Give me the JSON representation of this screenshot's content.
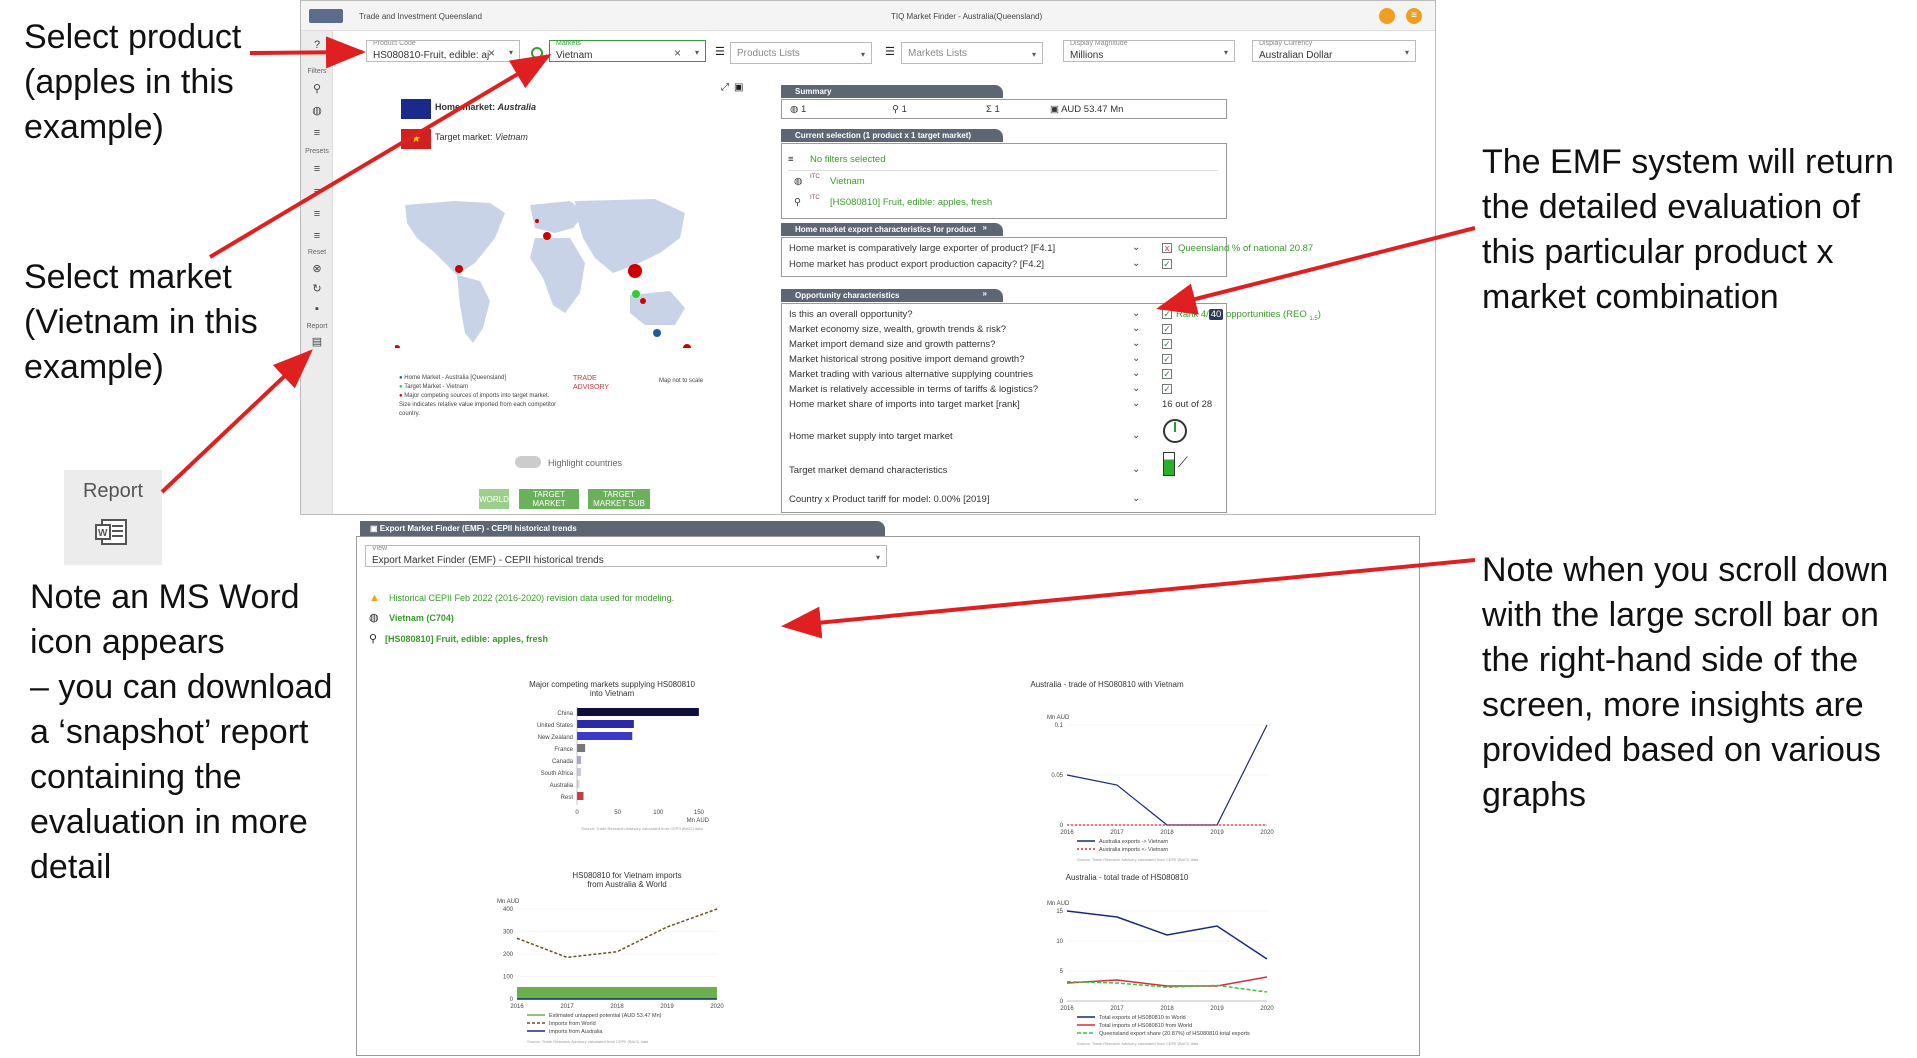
{
  "annotations": {
    "select_product": [
      "Select product",
      "(apples in this",
      "example)"
    ],
    "select_market": [
      "Select market",
      "(Vietnam in this",
      "example)"
    ],
    "report_label": "Report",
    "word_note": [
      "Note an MS Word",
      "icon appears",
      "– you can download",
      "a ‘snapshot’ report",
      "containing the",
      "evaluation in more",
      "detail"
    ],
    "emf_note": [
      "The EMF system will return",
      "the detailed evaluation of",
      "this particular product x",
      "market combination"
    ],
    "scroll_note": [
      "Note when you scroll down",
      "with the large scroll bar on",
      "the right-hand side of the",
      "screen, more insights are",
      "provided based on various",
      "graphs"
    ],
    "arrow_color": "#e02020"
  },
  "topbar": {
    "brand": "Trade and Investment Queensland",
    "title": "TIQ Market Finder - Australia(Queensland)"
  },
  "sidebar": {
    "filters": "Filters",
    "presets": "Presets",
    "reset": "Reset",
    "report": "Report"
  },
  "fields": {
    "product": {
      "caption": "Product Code",
      "value": "HS080810-Fruit, edible: aj"
    },
    "markets": {
      "caption": "Markets",
      "value": "Vietnam"
    },
    "products_lists": {
      "placeholder": "Products Lists"
    },
    "markets_lists": {
      "placeholder": "Markets Lists"
    },
    "magnitude": {
      "caption": "Display Magnitude",
      "value": "Millions"
    },
    "currency": {
      "caption": "Display Currency",
      "value": "Australian Dollar"
    }
  },
  "map": {
    "home_label": "Home market: ",
    "home_value": "Australia",
    "target_label": "Target market: ",
    "target_value": "Vietnam",
    "legend": [
      "Home Market - Australia [Queensland]",
      "Target Market - Vietnam",
      "Major competing sources of imports into target market.",
      "Size indicates relative value imported from each competitor",
      "country."
    ],
    "brand": "TRADE ADVISORY",
    "scale_note": "Map not to scale",
    "highlight": "Highlight countries",
    "buttons": [
      "WORLD",
      "TARGET MARKET REGION",
      "TARGET MARKET SUB REGION"
    ]
  },
  "summary": {
    "header": "Summary",
    "markets": "1",
    "products": "1",
    "combos": "1",
    "value": "AUD 53.47 Mn"
  },
  "selection": {
    "header": "Current selection (1 product x 1 target market)",
    "filters": "No filters selected",
    "market": "Vietnam",
    "product": "[HS080810] Fruit, edible: apples, fresh",
    "itc": "ITC"
  },
  "home_chars": {
    "header": "Home market export characteristics for product",
    "rows": [
      {
        "text": "Home market is comparatively large exporter of product? [F4.1]",
        "mark": "x",
        "note": "Queensland % of national 20.87"
      },
      {
        "text": "Home market has product export production capacity? [F4.2]",
        "mark": "✓",
        "note": ""
      }
    ]
  },
  "opp_chars": {
    "header": "Opportunity characteristics",
    "rank_prefix": "Rank 4/",
    "rank_badge": "40",
    "rank_suffix": "opportunities (REO",
    "rank_sub": "1.5",
    "rows": [
      "Is this an overall opportunity?",
      "Market economy size, wealth, growth trends & risk?",
      "Market import demand size and growth patterns?",
      "Market historical strong positive import demand growth?",
      "Market trading with various alternative supplying countries",
      "Market is relatively accessible in terms of tariffs & logistics?",
      "Home market share of imports into target market [rank]"
    ],
    "share_rank": "16 out of 28",
    "supply": "Home market supply into target market",
    "demand": "Target market demand characteristics",
    "tariff": "Country x Product tariff for model: 0.00% [2019]"
  },
  "emf": {
    "header": "Export Market Finder (EMF) - CEPII historical trends",
    "view_caption": "View",
    "view_value": "Export Market Finder (EMF) - CEPII historical trends",
    "note": "Historical CEPII Feb 2022 (2016-2020) revision data used for modeling.",
    "market": "Vietnam (C704)",
    "product": "[HS080810] Fruit, edible: apples, fresh"
  },
  "chart_data": [
    {
      "type": "bar",
      "title": "Major competing markets supplying HS080810 into Vietnam",
      "categories": [
        "China",
        "United States",
        "New Zealand",
        "France",
        "Canada",
        "South Africa",
        "Australia",
        "Rest"
      ],
      "values": [
        150,
        70,
        68,
        10,
        5,
        5,
        3,
        8
      ],
      "xlabel": "Mn AUD",
      "xticks": [
        "0",
        "50",
        "100",
        "150"
      ],
      "xlim": [
        0,
        160
      ],
      "colors": [
        "#0e0e3a",
        "#2a2aa8",
        "#3a3ac8",
        "#777777",
        "#aaaacc",
        "#c8c8d8",
        "#d8d8e0",
        "#c83a4a"
      ],
      "source": "Source: Trade Research Advisory calculated from CEPII (BACI) data"
    },
    {
      "type": "line",
      "title": "Australia - trade of HS080810 with Vietnam",
      "ylabel": "Mn AUD",
      "x": [
        2016,
        2017,
        2018,
        2019,
        2020
      ],
      "yticks": [
        "0",
        "0.05",
        "0.1"
      ],
      "ylim": [
        0,
        0.1
      ],
      "series": [
        {
          "name": "Australia exports -> Vietnam",
          "values": [
            0.05,
            0.04,
            0.0,
            0.0,
            0.1
          ],
          "color": "#1a2a7a"
        },
        {
          "name": "Australia imports <- Vietnam",
          "values": [
            0,
            0,
            0,
            0,
            0
          ],
          "color": "#d03040"
        }
      ],
      "source": "Source: Trade Research Advisory calculated from CEPII (BACI) data"
    },
    {
      "type": "line",
      "title": "HS080810 for Vietnam imports from Australia & World",
      "ylabel": "Mn AUD",
      "x": [
        2016,
        2017,
        2018,
        2019,
        2020
      ],
      "yticks": [
        "0",
        "100",
        "200",
        "300",
        "400"
      ],
      "ylim": [
        0,
        400
      ],
      "series": [
        {
          "name": "Estimated untapped potential (AUD 53.47 Mn)",
          "values": [
            53.47,
            53.47,
            53.47,
            53.47,
            53.47
          ],
          "color": "#6ab04c"
        },
        {
          "name": "Imports from World",
          "values": [
            270,
            185,
            210,
            320,
            400
          ],
          "color": "#6a5020"
        },
        {
          "name": "Imports from Australia",
          "values": [
            0,
            0,
            0,
            0,
            0
          ],
          "color": "#1a2a7a"
        }
      ],
      "source": "Source: Trade Research Advisory calculated from CEPII (BACI) data"
    },
    {
      "type": "line",
      "title": "Australia - total trade of HS080810",
      "ylabel": "Mn AUD",
      "x": [
        2016,
        2017,
        2018,
        2019,
        2020
      ],
      "yticks": [
        "0",
        "5",
        "10",
        "15"
      ],
      "ylim": [
        0,
        15
      ],
      "series": [
        {
          "name": "Total exports of HS080810 to World",
          "values": [
            15,
            14,
            11,
            12.5,
            7
          ],
          "color": "#1a2a7a"
        },
        {
          "name": "Total imports of HS080810 from World",
          "values": [
            3,
            3.5,
            2.5,
            2.5,
            4
          ],
          "color": "#d03040"
        },
        {
          "name": "Queensland export share (20.87%) of HS080810 total exports",
          "values": [
            3.2,
            3,
            2.3,
            2.6,
            1.5
          ],
          "color": "#40c040"
        }
      ],
      "source": "Source: Trade Research Advisory calculated from CEPII (BACI) data"
    }
  ]
}
